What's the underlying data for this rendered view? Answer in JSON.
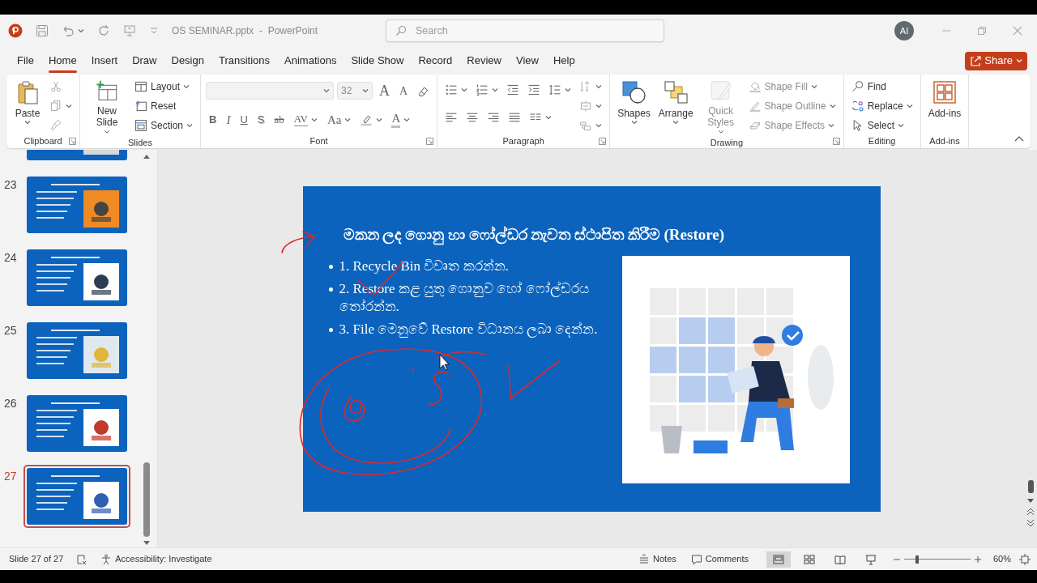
{
  "title_bar": {
    "file_title": "OS SEMINAR.pptx  -  PowerPoint",
    "search_placeholder": "Search",
    "account_initials": "AI"
  },
  "menu_tabs": [
    {
      "label": "File",
      "selected": false
    },
    {
      "label": "Home",
      "selected": true
    },
    {
      "label": "Insert",
      "selected": false
    },
    {
      "label": "Draw",
      "selected": false
    },
    {
      "label": "Design",
      "selected": false
    },
    {
      "label": "Transitions",
      "selected": false
    },
    {
      "label": "Animations",
      "selected": false
    },
    {
      "label": "Slide Show",
      "selected": false
    },
    {
      "label": "Record",
      "selected": false
    },
    {
      "label": "Review",
      "selected": false
    },
    {
      "label": "View",
      "selected": false
    },
    {
      "label": "Help",
      "selected": false
    }
  ],
  "share_button": "Share",
  "ribbon_groups": [
    {
      "label": "Clipboard",
      "items": [
        {
          "kind": "large",
          "label": "Paste",
          "disabled": false
        },
        {
          "kind": "icon",
          "disabled": true
        },
        {
          "kind": "icon",
          "disabled": true
        },
        {
          "kind": "icon",
          "disabled": true
        }
      ]
    },
    {
      "label": "Slides",
      "items": [
        {
          "kind": "large",
          "label": "New Slide",
          "disabled": false
        },
        {
          "kind": "small",
          "label": "Layout",
          "disabled": false
        },
        {
          "kind": "small",
          "label": "Reset",
          "disabled": false
        },
        {
          "kind": "small",
          "label": "Section",
          "disabled": false
        }
      ]
    },
    {
      "label": "Font",
      "items": [
        {
          "kind": "field",
          "disabled": true
        },
        {
          "kind": "field",
          "value": "32",
          "disabled": true
        },
        {
          "kind": "glyph",
          "text": "A",
          "disabled": false
        },
        {
          "kind": "glyph",
          "text": "A",
          "disabled": false
        },
        {
          "kind": "icon",
          "disabled": false
        },
        {
          "kind": "glyph",
          "text": "B",
          "disabled": false
        },
        {
          "kind": "glyph",
          "text": "I",
          "disabled": false
        },
        {
          "kind": "glyph",
          "text": "U",
          "disabled": false
        },
        {
          "kind": "glyph",
          "text": "S",
          "disabled": false
        },
        {
          "kind": "glyph",
          "text": "ab",
          "disabled": false
        },
        {
          "kind": "glyph",
          "text": "AV",
          "disabled": false
        },
        {
          "kind": "glyph",
          "text": "Aa",
          "disabled": false
        },
        {
          "kind": "icon",
          "disabled": false
        },
        {
          "kind": "glyph",
          "text": "A",
          "disabled": false
        }
      ]
    },
    {
      "label": "Paragraph",
      "items": [
        {
          "kind": "icon",
          "disabled": false
        },
        {
          "kind": "icon",
          "disabled": false
        },
        {
          "kind": "icon",
          "disabled": false
        },
        {
          "kind": "icon",
          "disabled": false
        },
        {
          "kind": "icon",
          "disabled": false
        },
        {
          "kind": "icon",
          "disabled": false
        },
        {
          "kind": "icon",
          "disabled": false
        },
        {
          "kind": "icon",
          "disabled": false
        },
        {
          "kind": "icon",
          "disabled": false
        },
        {
          "kind": "icon",
          "disabled": false
        },
        {
          "kind": "icon",
          "disabled": true
        },
        {
          "kind": "icon",
          "disabled": true
        },
        {
          "kind": "icon",
          "disabled": true
        }
      ]
    },
    {
      "label": "Drawing",
      "items": [
        {
          "kind": "large",
          "label": "Shapes",
          "disabled": false
        },
        {
          "kind": "large",
          "label": "Arrange",
          "disabled": false
        },
        {
          "kind": "large",
          "label": "Quick Styles",
          "disabled": true
        },
        {
          "kind": "small",
          "label": "Shape Fill",
          "disabled": true
        },
        {
          "kind": "small",
          "label": "Shape Outline",
          "disabled": true
        },
        {
          "kind": "small",
          "label": "Shape Effects",
          "disabled": true
        }
      ]
    },
    {
      "label": "Editing",
      "items": [
        {
          "kind": "small",
          "label": "Find",
          "disabled": false
        },
        {
          "kind": "small",
          "label": "Replace",
          "disabled": false
        },
        {
          "kind": "small",
          "label": "Select",
          "disabled": false
        }
      ]
    },
    {
      "label": "Add-ins",
      "items": [
        {
          "kind": "large",
          "label": "Add-ins",
          "disabled": false
        }
      ]
    }
  ],
  "thumbnails": [
    {
      "selected": false
    },
    {
      "number": "23",
      "selected": false
    },
    {
      "number": "24",
      "selected": false
    },
    {
      "number": "25",
      "selected": false
    },
    {
      "number": "26",
      "selected": false
    },
    {
      "number": "27",
      "selected": true
    }
  ],
  "slide": {
    "title": "මකන ලද ගොනු හා ෆෝල්ඩර නැවත ස්ථාපිත කිරීම (Restore)",
    "bullets": [
      "1. Recycle Bin විවෘත කරන්න.",
      "2. Restore කළ යුතු ගොනුව හෝ ෆෝල්ඩරය තෝරන්න.",
      "3. File මෙනුවේ Restore විධානය ලබා දෙන්න."
    ]
  },
  "status_bar": {
    "slide_position": "Slide 27 of 27",
    "accessibility": "Accessibility: Investigate",
    "notes": "Notes",
    "comments": "Comments",
    "views": [
      {
        "selected": true
      },
      {
        "selected": false
      },
      {
        "selected": false
      },
      {
        "selected": false
      }
    ],
    "zoom_slider": {
      "level": 0.2
    },
    "zoom": "60%"
  }
}
